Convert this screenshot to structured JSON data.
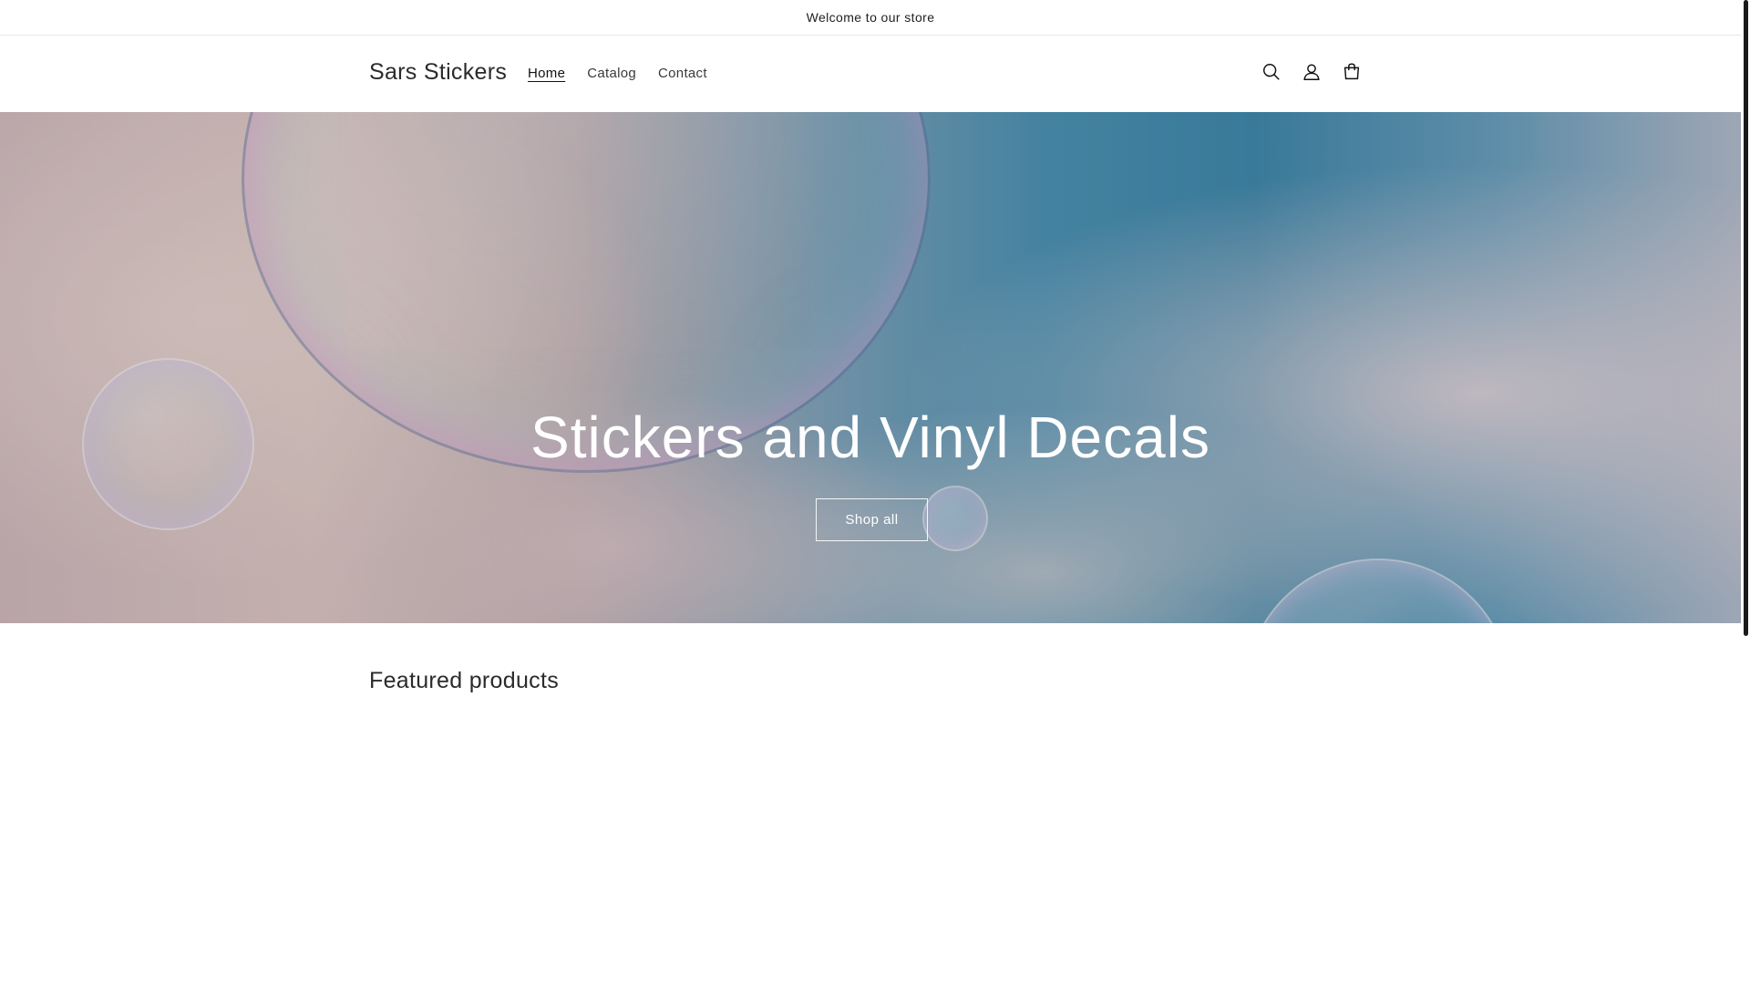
{
  "announcement": {
    "text": "Welcome to our store"
  },
  "header": {
    "logo": "Sars Stickers",
    "nav": [
      {
        "label": "Home",
        "active": true
      },
      {
        "label": "Catalog",
        "active": false
      },
      {
        "label": "Contact",
        "active": false
      }
    ],
    "icons": [
      "search-icon",
      "account-icon",
      "cart-icon"
    ]
  },
  "hero": {
    "title": "Stickers and Vinyl Decals",
    "button_label": "Shop all"
  },
  "featured": {
    "title": "Featured products"
  },
  "colors": {
    "text": "#121212",
    "hero_text": "#ffffff",
    "sky_blue": "#3e8cae",
    "cloud_pink": "#e6cfc7"
  }
}
